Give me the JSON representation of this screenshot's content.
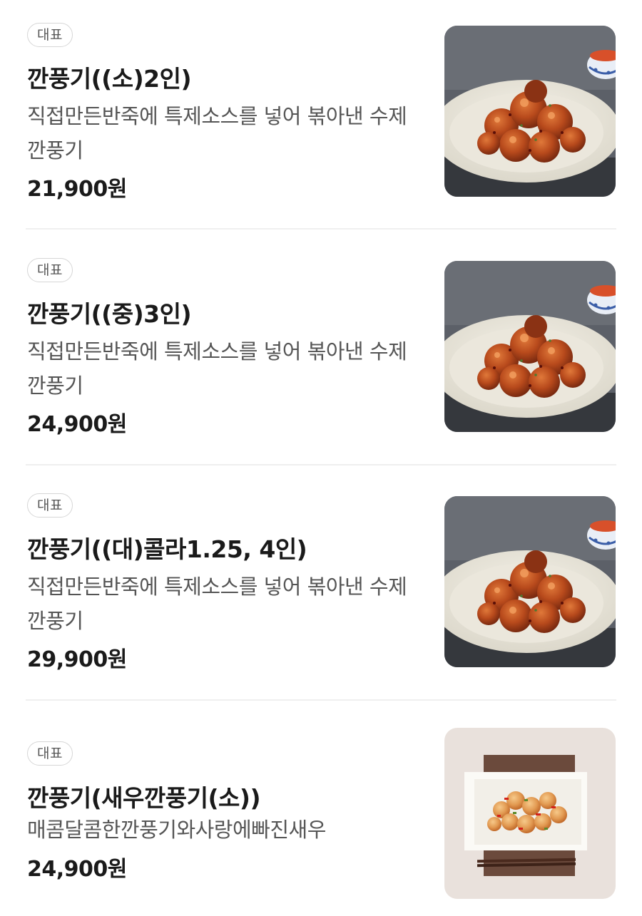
{
  "menu": {
    "items": [
      {
        "badge": "대표",
        "name": "깐풍기((소)2인)",
        "description": "직접만든반죽에 특제소스를 넣어 볶아낸 수제 깐풍기",
        "price": "21,900원",
        "image_icon": "kkanpunggi-dish-image"
      },
      {
        "badge": "대표",
        "name": "깐풍기((중)3인)",
        "description": "직접만든반죽에 특제소스를 넣어 볶아낸 수제 깐풍기",
        "price": "24,900원",
        "image_icon": "kkanpunggi-dish-image"
      },
      {
        "badge": "대표",
        "name": "깐풍기((대)콜라1.25, 4인)",
        "description": "직접만든반죽에 특제소스를 넣어 볶아낸 수제 깐풍기",
        "price": "29,900원",
        "image_icon": "kkanpunggi-dish-image"
      },
      {
        "badge": "대표",
        "name": "깐풍기(새우깐풍기(소))",
        "description": "매콤달콤한깐풍기와사랑에빠진새우",
        "price": "24,900원",
        "image_icon": "shrimp-kkanpunggi-dish-image"
      }
    ]
  },
  "colors": {
    "text_primary": "#1a1a1a",
    "text_secondary": "#555555",
    "badge_border": "#d6d6d6",
    "divider": "#efefef"
  }
}
